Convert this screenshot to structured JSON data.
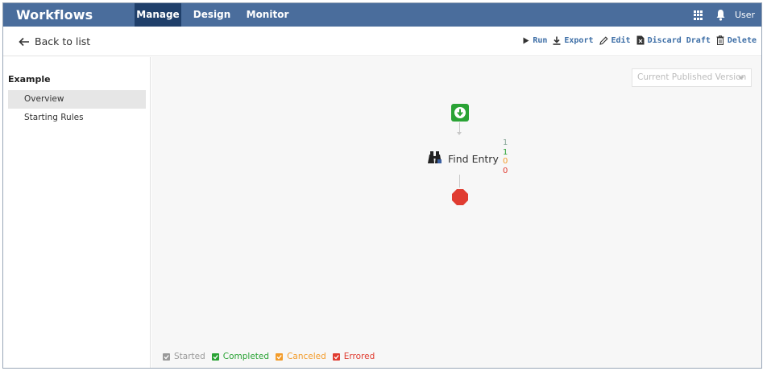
{
  "colors": {
    "topbar": "#4a6d9c",
    "active_tab": "#1f3f6a",
    "link": "#3d6ea6",
    "started": "#9a9a9a",
    "completed": "#2aa335",
    "canceled": "#f39c2b",
    "errored": "#e03c31"
  },
  "header": {
    "brand": "Workflows",
    "tabs": [
      {
        "label": "Manage",
        "active": true
      },
      {
        "label": "Design",
        "active": false
      },
      {
        "label": "Monitor",
        "active": false
      }
    ],
    "user": "User",
    "icons": [
      "apps-grid-icon",
      "bell-icon"
    ]
  },
  "toolbar": {
    "back_label": "Back to list",
    "actions": [
      {
        "label": "Run",
        "icon": "play-icon"
      },
      {
        "label": "Export",
        "icon": "download-icon"
      },
      {
        "label": "Edit",
        "icon": "pencil-icon"
      },
      {
        "label": "Discard Draft",
        "icon": "discard-draft-icon"
      },
      {
        "label": "Delete",
        "icon": "trash-icon"
      }
    ]
  },
  "sidebar": {
    "title": "Example",
    "items": [
      {
        "label": "Overview",
        "selected": true
      },
      {
        "label": "Starting Rules",
        "selected": false
      }
    ]
  },
  "canvas": {
    "version_select": "Current Published Version",
    "task": {
      "label": "Find Entry",
      "icon": "binoculars-icon",
      "counts": {
        "started": "1",
        "completed": "1",
        "canceled": "0",
        "errored": "0"
      }
    }
  },
  "legend": [
    {
      "label": "Started",
      "color": "#9a9a9a"
    },
    {
      "label": "Completed",
      "color": "#2aa335"
    },
    {
      "label": "Canceled",
      "color": "#f39c2b"
    },
    {
      "label": "Errored",
      "color": "#e03c31"
    }
  ]
}
